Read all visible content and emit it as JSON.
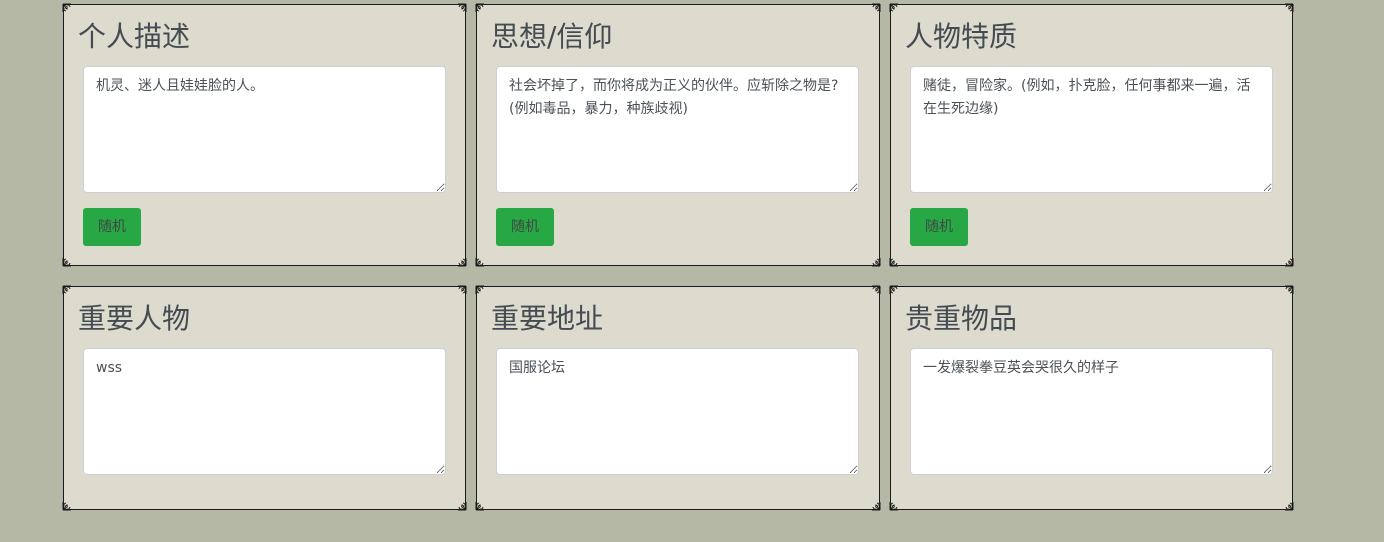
{
  "cards": [
    {
      "title": "个人描述",
      "text": "机灵、迷人且娃娃脸的人。",
      "button_label": "随机"
    },
    {
      "title": "思想/信仰",
      "text": "社会坏掉了，而你将成为正义的伙伴。应斩除之物是?(例如毒品，暴力，种族歧视)",
      "button_label": "随机"
    },
    {
      "title": "人物特质",
      "text": "赌徒，冒险家。(例如，扑克脸，任何事都来一遍，活在生死边缘)",
      "button_label": "随机"
    },
    {
      "title": "重要人物",
      "text": "wss"
    },
    {
      "title": "重要地址",
      "text": "国服论坛"
    },
    {
      "title": "贵重物品",
      "text": "一发爆裂拳豆英会哭很久的样子"
    }
  ],
  "colors": {
    "page_background": "#b5b8a5",
    "card_background": "#dddbcd",
    "button_green": "#28a745",
    "title_text": "#454b52"
  },
  "icons": {
    "card_corner": "ornament-corner-icon"
  }
}
